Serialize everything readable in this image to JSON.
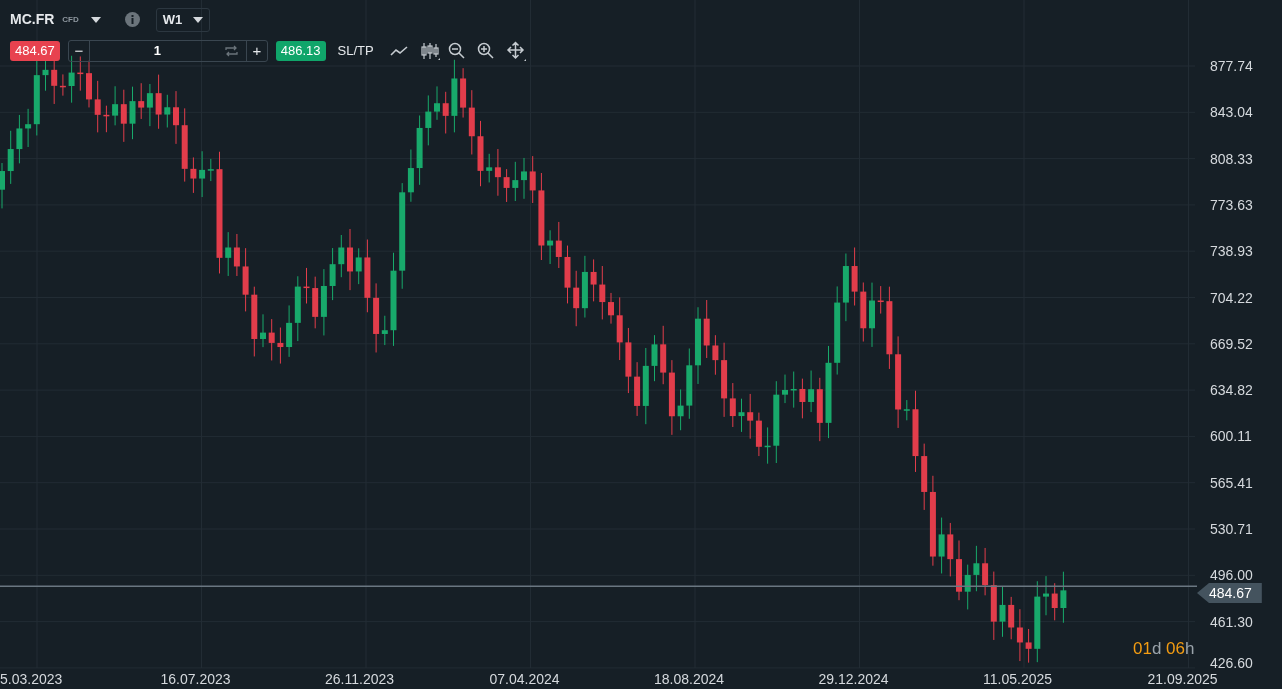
{
  "instrument": {
    "symbol": "MC.FR",
    "type": "CFD",
    "timeframe": "W1"
  },
  "order": {
    "sell_price": "484.67",
    "minus": "−",
    "quantity": "1",
    "plus": "+",
    "buy_price": "486.13",
    "sltp": "SL/TP"
  },
  "price_axis": [
    "877.74",
    "843.04",
    "808.33",
    "773.63",
    "738.93",
    "704.22",
    "669.52",
    "634.82",
    "600.11",
    "565.41",
    "530.71",
    "496.00",
    "461.30",
    "426.60"
  ],
  "current_price": "484.67",
  "countdown": [
    {
      "text": "01",
      "kind": "value"
    },
    {
      "text": "d",
      "kind": "unit"
    },
    {
      "text": " 06",
      "kind": "value"
    },
    {
      "text": "h",
      "kind": "unit"
    }
  ],
  "date_axis": [
    "5.03.2023",
    "16.07.2023",
    "26.11.2023",
    "07.04.2024",
    "18.08.2024",
    "29.12.2024",
    "11.05.2025",
    "21.09.2025"
  ]
}
